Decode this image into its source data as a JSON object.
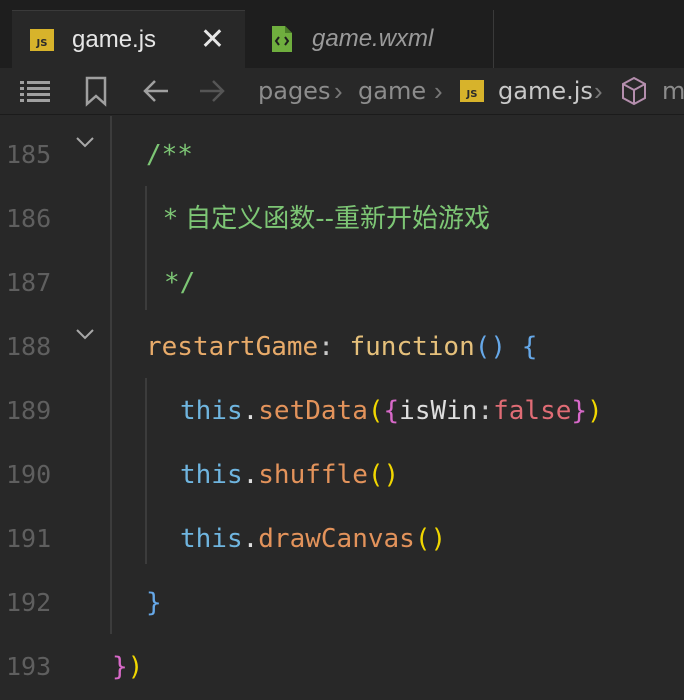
{
  "tabs": [
    {
      "icon": "JS",
      "label": "game.js",
      "close": "✕"
    },
    {
      "label": "game.wxml"
    }
  ],
  "breadcrumb": {
    "items": [
      "pages",
      "game",
      "game.js",
      "m"
    ],
    "separator": "›",
    "js_icon": "JS"
  },
  "code": {
    "lines": [
      {
        "n": "185",
        "text": "/**"
      },
      {
        "n": "186",
        "text": "* 自定义函数--重新开始游戏"
      },
      {
        "n": "187",
        "text": "*/"
      },
      {
        "n": "188",
        "prop": "restartGame",
        "colon": ":",
        "kw": "function",
        "parens": "()",
        "brace": "{"
      },
      {
        "n": "189",
        "this": "this",
        "dot": ".",
        "fn": "setData",
        "p_open": "(",
        "b_open": "{",
        "key": "isWin",
        "colon": ":",
        "val": "false",
        "b_close": "}",
        "p_close": ")"
      },
      {
        "n": "190",
        "this": "this",
        "dot": ".",
        "fn": "shuffle",
        "parens": "()"
      },
      {
        "n": "191",
        "this": "this",
        "dot": ".",
        "fn": "drawCanvas",
        "parens": "()"
      },
      {
        "n": "192",
        "brace": "}"
      },
      {
        "n": "193",
        "brace": "}",
        "paren": ")"
      }
    ]
  },
  "colors": {
    "comment": "#7dc675",
    "property": "#e8ab6a",
    "keyword": "#e5c07b",
    "this": "#6fb5df",
    "method": "#e3935b",
    "boolean": "#e06c75",
    "bracket_pink": "#d869c9",
    "bracket_blue": "#66a8e8",
    "bracket_yellow": "#f1d700"
  },
  "icons": [
    "js-file-icon",
    "close-icon",
    "wxml-file-icon",
    "outline-list-icon",
    "bookmark-icon",
    "back-arrow-icon",
    "forward-arrow-icon",
    "cube-symbol-icon",
    "fold-chevron-icon"
  ]
}
